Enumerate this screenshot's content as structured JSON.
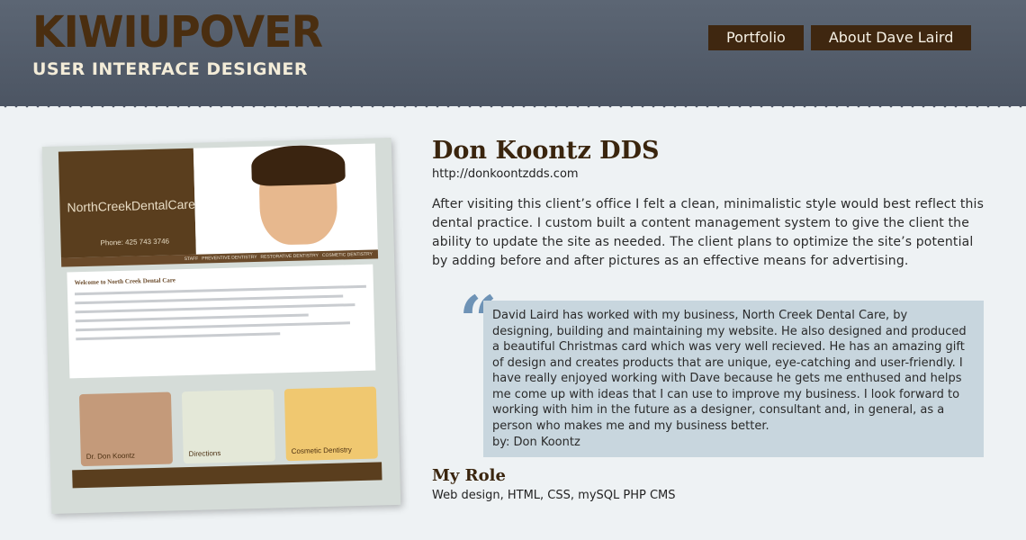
{
  "header": {
    "logo_title": "KIWIUPOVER",
    "logo_subtitle": "USER INTERFACE DESIGNER",
    "nav": [
      {
        "label": "Portfolio"
      },
      {
        "label": "About Dave Laird"
      }
    ]
  },
  "screenshot": {
    "brand": "NorthCreekDentalCare",
    "phone": "Phone: 425 743 3746",
    "nav_items": [
      "STAFF",
      "PREVENTIVE DENTISTRY",
      "RESTORATIVE DENTISTRY",
      "COSMETIC DENTISTRY"
    ],
    "heading": "Welcome to North Creek Dental Care",
    "thumbs": [
      {
        "label": "Dr. Don Koontz"
      },
      {
        "label": "Directions"
      },
      {
        "label": "Cosmetic Dentistry"
      }
    ]
  },
  "project": {
    "title": "Don Koontz DDS",
    "url": "http://donkoontzdds.com",
    "description": "After visiting this client’s office I felt a clean, minimalistic style would best reflect this dental practice. I custom built a content management system to give the client the ability to update the site as needed. The client plans to optimize the site’s potential by adding before and after pictures as an effective means for advertising.",
    "quote": "David Laird has worked with my business, North Creek Dental Care, by designing, building and maintaining my website. He also designed and produced a beautiful Christmas card which was very well recieved. He has an amazing gift of design and creates products that are unique, eye-catching and user-friendly. I have really enjoyed working with Dave because he gets me enthused and helps me come up with ideas that I can use to improve my business. I look forward to working with him in the future as a designer, consultant and, in general, as a person who makes me and my business better.",
    "quote_by": "by: Don Koontz",
    "role_title": "My Role",
    "role_text": "Web design, HTML, CSS, mySQL PHP CMS"
  },
  "colors": {
    "header_bg": "#505a68",
    "brown": "#3f2710",
    "quote_bg": "#c8d6de",
    "quote_mark": "#6e93b6"
  }
}
